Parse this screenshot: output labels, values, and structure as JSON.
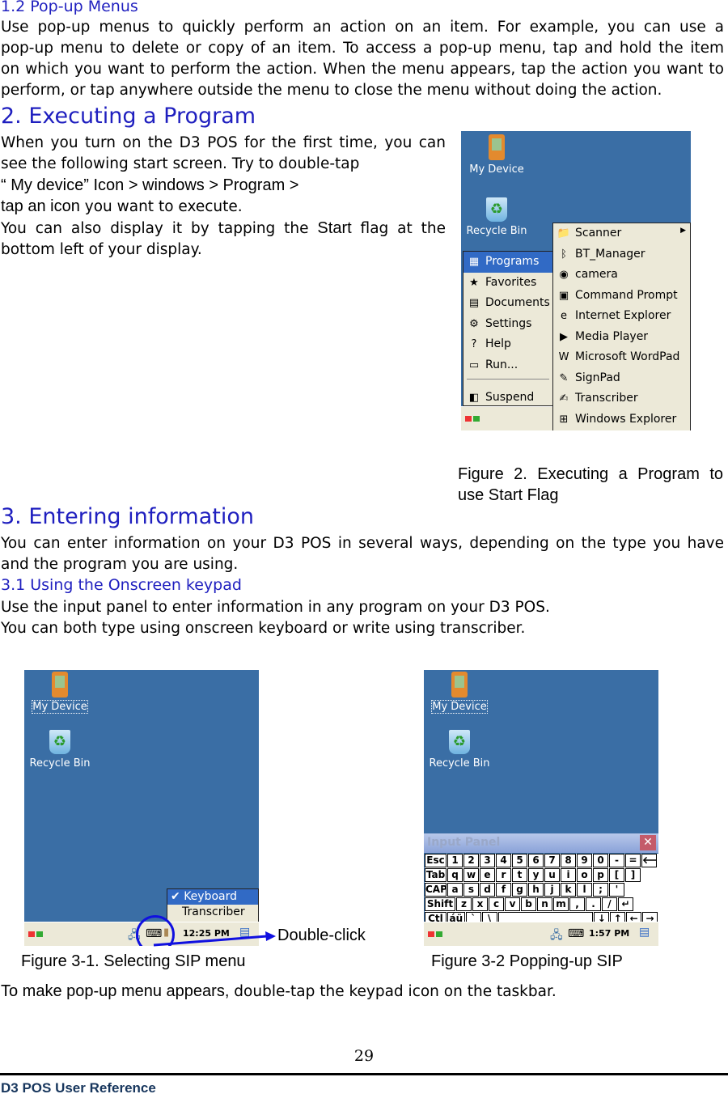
{
  "s12": {
    "heading": "1.2 Pop-up Menus",
    "lines": [
      "Use pop-up menus to quickly perform an action on an item. For example, you can use a",
      "pop-up menu to delete or copy of an item. To access a pop-up menu, tap and hold the item",
      "on which you want to perform the action. When the menu appears, tap the action you want to",
      "perform, or tap anywhere outside the menu to close the menu without doing the action."
    ]
  },
  "s2": {
    "heading": "2. Executing a Program",
    "lines": [
      "When you turn on the D3 POS for the first time, you can",
      "see the following start screen. Try to double-tap",
      "“ My device”  Icon > windows > Program >",
      "tap an icon you want to execute.",
      "You can also display it by tapping the Start flag at the",
      "bottom left of your display."
    ],
    "line4_em": "tap an icon",
    "line4_rest": " you want to execute.",
    "line5_a": "You can also display it by tapping the ",
    "line5_em": "Start",
    "line5_b": " flag at the",
    "caption": [
      "Figure 2. Executing a Program to",
      "use Start Flag"
    ]
  },
  "fig2": {
    "desktop_icons": [
      "My Device",
      "Recycle Bin"
    ],
    "start_menu": [
      {
        "label": "Programs",
        "icon": "programs-icon",
        "glyph": "▦"
      },
      {
        "label": "Favorites",
        "icon": "star-icon",
        "glyph": "★"
      },
      {
        "label": "Documents",
        "icon": "documents-icon",
        "glyph": "▤"
      },
      {
        "label": "Settings",
        "icon": "settings-icon",
        "glyph": "⚙"
      },
      {
        "label": "Help",
        "icon": "help-book-icon",
        "glyph": "?"
      },
      {
        "label": "Run...",
        "icon": "run-icon",
        "glyph": "▭"
      },
      {
        "label": "Suspend",
        "icon": "suspend-icon",
        "glyph": "◧"
      }
    ],
    "programs_menu": [
      {
        "label": "Scanner",
        "icon": "folder-icon",
        "glyph": "📁"
      },
      {
        "label": "BT_Manager",
        "icon": "bluetooth-icon",
        "glyph": "ᛒ"
      },
      {
        "label": "camera",
        "icon": "camera-icon",
        "glyph": "◉"
      },
      {
        "label": "Command Prompt",
        "icon": "command-prompt-icon",
        "glyph": "▣"
      },
      {
        "label": "Internet Explorer",
        "icon": "internet-explorer-icon",
        "glyph": "e"
      },
      {
        "label": "Media Player",
        "icon": "media-player-icon",
        "glyph": "▶"
      },
      {
        "label": "Microsoft WordPad",
        "icon": "wordpad-icon",
        "glyph": "W"
      },
      {
        "label": "SignPad",
        "icon": "signpad-icon",
        "glyph": "✎"
      },
      {
        "label": "Transcriber",
        "icon": "transcriber-icon",
        "glyph": "✍"
      },
      {
        "label": "Windows Explorer",
        "icon": "windows-explorer-icon",
        "glyph": "⊞"
      }
    ]
  },
  "s3": {
    "heading": "3. Entering information",
    "lines": [
      "You can enter information on your D3 POS in several ways, depending on the type you have",
      "and the program you are using."
    ]
  },
  "s31": {
    "heading": "3.1 Using the Onscreen keypad",
    "lines": [
      "Use the input panel to enter information in any program on your D3 POS.",
      "You can both type using onscreen keyboard or write using transcriber."
    ]
  },
  "fig31": {
    "desktop_icons": [
      "My Device",
      "Recycle Bin"
    ],
    "sip_menu": [
      "Keyboard",
      "Transcriber"
    ],
    "time": "12:25 PM",
    "annotation": "Double-click",
    "caption": "Figure 3-1. Selecting SIP menu"
  },
  "fig32": {
    "desktop_icons": [
      "My Device",
      "Recycle Bin"
    ],
    "panel_title": "Input Panel",
    "time": "1:57 PM",
    "caption": "Figure 3-2 Popping-up SIP",
    "keys": [
      [
        "Esc",
        "1",
        "2",
        "3",
        "4",
        "5",
        "6",
        "7",
        "8",
        "9",
        "0",
        "-",
        "=",
        "🡐"
      ],
      [
        "Tab",
        "q",
        "w",
        "e",
        "r",
        "t",
        "y",
        "u",
        "i",
        "o",
        "p",
        "[",
        "]"
      ],
      [
        "CAP",
        "a",
        "s",
        "d",
        "f",
        "g",
        "h",
        "j",
        "k",
        "l",
        ";",
        "'"
      ],
      [
        "Shift",
        "z",
        "x",
        "c",
        "v",
        "b",
        "n",
        "m",
        ",",
        ".",
        "/",
        "↵"
      ],
      [
        "Ctl",
        "áü",
        "`",
        "\\",
        " ",
        "↓",
        "↑",
        "←",
        "→"
      ]
    ]
  },
  "closing": {
    "em": "To make pop-up menu appears,",
    "rest": " double-tap the keypad icon on the taskbar."
  },
  "footer": {
    "page_number": "29",
    "doc_title": "D3 POS User Reference"
  },
  "colors": {
    "heading": "#1f1fbf",
    "desktop": "#3a6ea5",
    "menu_bg": "#ece9d8",
    "selection": "#316ac5"
  }
}
